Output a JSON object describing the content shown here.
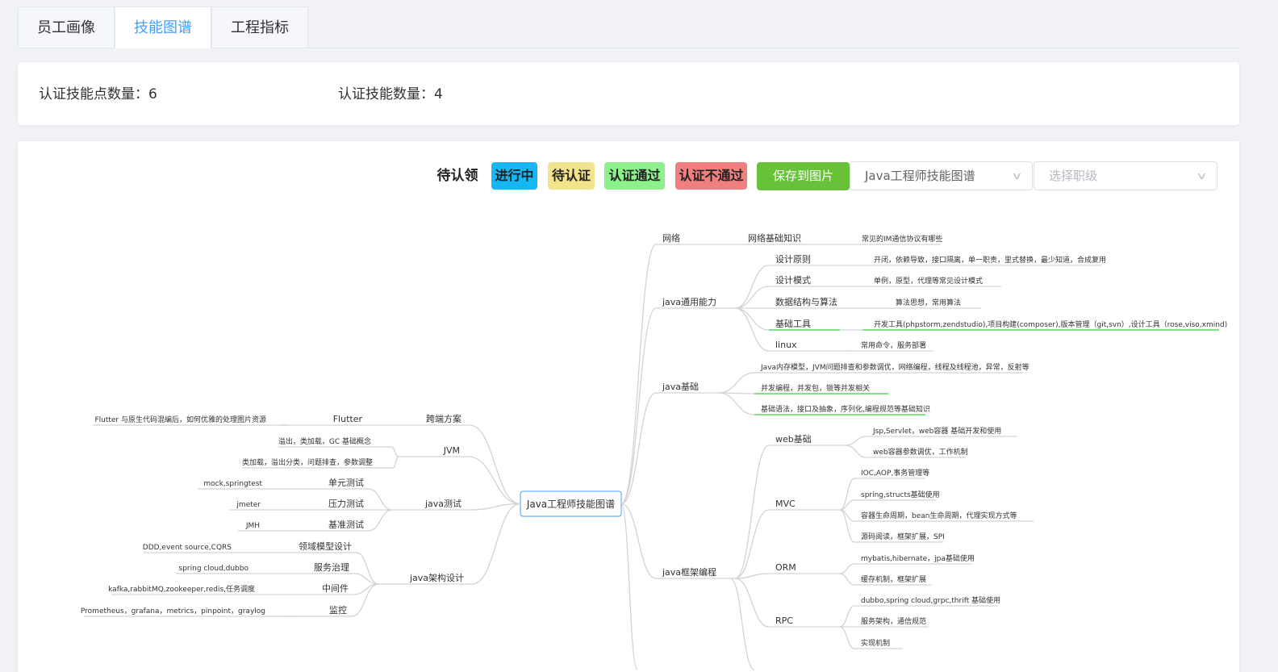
{
  "tabs": [
    "员工画像",
    "技能图谱",
    "工程指标"
  ],
  "stats": {
    "points_label": "认证技能点数量：6",
    "skills_label": "认证技能数量：4"
  },
  "legend": {
    "unclaimed": "待认领",
    "in_progress": "进行中",
    "pending": "待认证",
    "passed": "认证通过",
    "failed": "认证不通过"
  },
  "colors": {
    "in_progress": "#17b7f5",
    "pending": "#f2e48e",
    "passed": "#8cf08c",
    "failed": "#f08080",
    "save": "#67c23a",
    "accent": "#409eff"
  },
  "save_label": "保存到图片",
  "map_select": {
    "value": "Java工程师技能图谱"
  },
  "level_select": {
    "placeholder": "选择职级"
  },
  "mindmap": {
    "root": "Java工程师技能图谱",
    "right": [
      {
        "label": "网络",
        "children": [
          {
            "label": "网络基础知识",
            "children": [
              "常见的IM通信协议有哪些"
            ]
          }
        ]
      },
      {
        "label": "java通用能力",
        "children": [
          {
            "label": "设计原则",
            "children": [
              "开闭，依赖导致，接口隔离，单一职责，里式替换，最少知道，合成复用"
            ]
          },
          {
            "label": "设计模式",
            "children": [
              "单例，原型，代理等常见设计模式"
            ]
          },
          {
            "label": "数据结构与算法",
            "children": [
              "算法思想，常用算法"
            ]
          },
          {
            "label": "基础工具",
            "children": [
              "开发工具(phpstorm,zendstudio),项目构建(composer),版本管理（git,svn）,设计工具（rose,viso,xmind)"
            ]
          },
          {
            "label": "linux",
            "children": [
              "常用命令，服务部署"
            ]
          }
        ]
      },
      {
        "label": "java基础",
        "children": [
          "Java内存模型，JVM问题排查和参数调优，网络编程，线程及线程池，异常，反射等",
          "并发编程，并发包，锁等并发相关",
          "基础语法，接口及抽象，序列化,编程规范等基础知识"
        ]
      },
      {
        "label": "java框架编程",
        "children": [
          {
            "label": "web基础",
            "children": [
              "Jsp,Servlet，web容器 基础开发和使用",
              "web容器参数调优，工作机制"
            ]
          },
          {
            "label": "MVC",
            "children": [
              "IOC,AOP,事务管理等",
              "spring,structs基础使用",
              "容器生命周期，bean生命周期，代理实现方式等",
              "源码阅读，框架扩展，SPI"
            ]
          },
          {
            "label": "ORM",
            "children": [
              "mybatis,hibernate，jpa基础使用",
              "缓存机制，框架扩展"
            ]
          },
          {
            "label": "RPC",
            "children": [
              "dubbo,spring cloud,grpc,thrift 基础使用",
              "服务架构，通信规范",
              "实现机制"
            ]
          }
        ]
      }
    ],
    "left": [
      {
        "label": "跨端方案",
        "children": [
          {
            "label": "Flutter",
            "children": [
              "Flutter 与原生代码混编后，如何优雅的处理图片资源"
            ]
          }
        ]
      },
      {
        "label": "JVM",
        "children": [
          "溢出，类加载，GC 基础概念",
          "类加载，溢出分类，问题排查，参数调整"
        ]
      },
      {
        "label": "java测试",
        "children": [
          {
            "label": "单元测试",
            "children": [
              "mock,springtest"
            ]
          },
          {
            "label": "压力测试",
            "children": [
              "jmeter"
            ]
          },
          {
            "label": "基准测试",
            "children": [
              "JMH"
            ]
          }
        ]
      },
      {
        "label": "java架构设计",
        "children": [
          {
            "label": "领域模型设计",
            "children": [
              "DDD,event source,CQRS"
            ]
          },
          {
            "label": "服务治理",
            "children": [
              "spring cloud,dubbo"
            ]
          },
          {
            "label": "中间件",
            "children": [
              "kafka,rabbitMQ,zookeeper,redis,任务调度"
            ]
          },
          {
            "label": "监控",
            "children": [
              "Prometheus，grafana，metrics，pinpoint，graylog"
            ]
          }
        ]
      }
    ],
    "passed_nodes": [
      "基础工具",
      "开发工具(phpstorm,zendstudio),项目构建(composer),版本管理（git,svn）,设计工具（rose,viso,xmind)",
      "并发编程，并发包，锁等并发相关",
      "基础语法，接口及抽象，序列化,编程规范等基础知识"
    ]
  }
}
